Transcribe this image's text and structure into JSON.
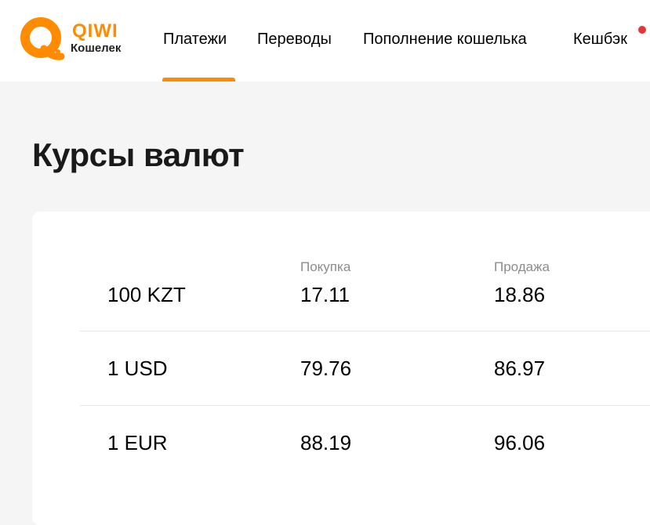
{
  "brand": {
    "name": "QIWI",
    "sub": "Кошелек",
    "color": "#ff8c00"
  },
  "nav": {
    "items": [
      {
        "label": "Платежи",
        "active": true
      },
      {
        "label": "Переводы",
        "active": false
      },
      {
        "label": "Пополнение кошелька",
        "active": false
      },
      {
        "label": "Кешбэк",
        "active": false,
        "has_notification": true
      }
    ],
    "accent": "#ff8c00",
    "notification_color": "#e63535"
  },
  "page": {
    "title": "Курсы валют"
  },
  "rates": {
    "headers": {
      "buy": "Покупка",
      "sell": "Продажа"
    },
    "rows": [
      {
        "currency": "100 KZT",
        "buy": "17.11",
        "sell": "18.86"
      },
      {
        "currency": "1 USD",
        "buy": "79.76",
        "sell": "86.97"
      },
      {
        "currency": "1 EUR",
        "buy": "88.19",
        "sell": "96.06"
      }
    ]
  }
}
